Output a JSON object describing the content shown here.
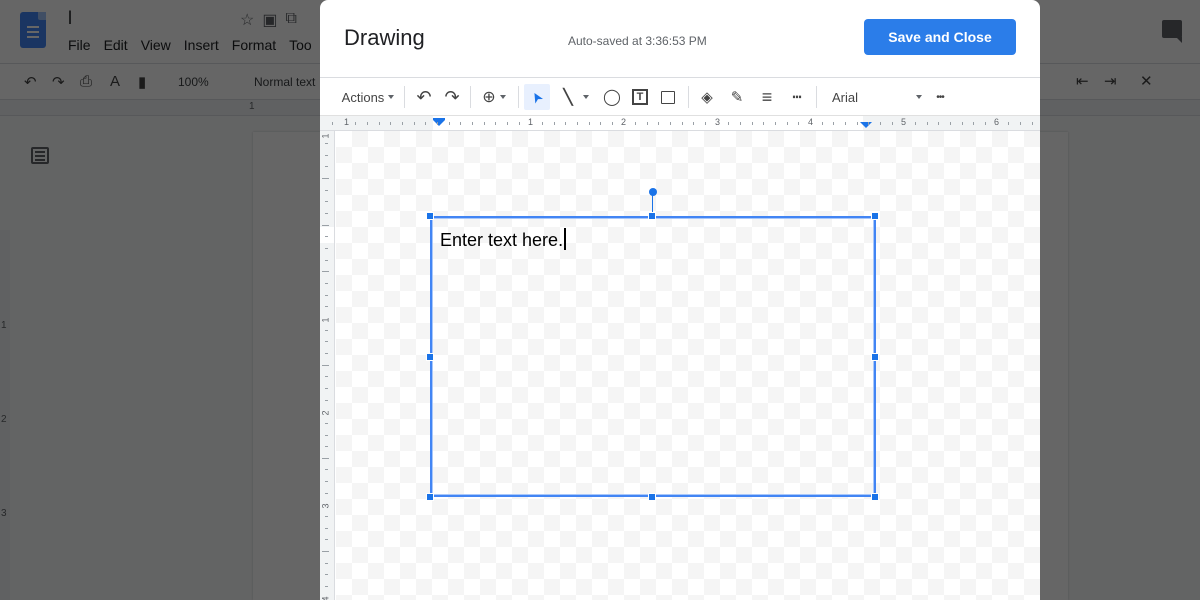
{
  "docs": {
    "title": "l",
    "menu": [
      "File",
      "Edit",
      "View",
      "Insert",
      "Format",
      "Too"
    ],
    "toolbar": {
      "zoom": "100%",
      "style": "Normal text"
    },
    "ruler_label": "1",
    "left_ruler_labels": [
      "1",
      "2",
      "3"
    ]
  },
  "dialog": {
    "title": "Drawing",
    "autosave": "Auto-saved at 3:36:53 PM",
    "save_button": "Save and Close",
    "toolbar": {
      "actions_label": "Actions",
      "font": "Arial",
      "items": [
        {
          "name": "undo-icon",
          "glyph": "↶"
        },
        {
          "name": "redo-icon",
          "glyph": "↷"
        },
        {
          "name": "zoom-icon",
          "glyph": "⊕"
        },
        {
          "name": "select-icon",
          "glyph": "➤"
        },
        {
          "name": "line-icon",
          "glyph": "╲"
        },
        {
          "name": "shape-icon",
          "glyph": "◯"
        },
        {
          "name": "text-box-icon",
          "glyph": "T"
        },
        {
          "name": "image-icon",
          "glyph": "▭"
        },
        {
          "name": "fill-color-icon",
          "glyph": "◈"
        },
        {
          "name": "border-color-icon",
          "glyph": "✎"
        },
        {
          "name": "border-weight-icon",
          "glyph": "≡"
        },
        {
          "name": "border-dash-icon",
          "glyph": "┅"
        },
        {
          "name": "more-icon",
          "glyph": "•••"
        }
      ]
    },
    "hruler_labels": [
      "1",
      "1",
      "2",
      "3",
      "4",
      "5",
      "6"
    ],
    "vruler_labels": [
      "1",
      "1",
      "2",
      "3",
      "4"
    ],
    "textbox": {
      "text": "Enter text here."
    }
  },
  "colors": {
    "accent": "#1a73e8",
    "save_button": "#2b7de9"
  }
}
